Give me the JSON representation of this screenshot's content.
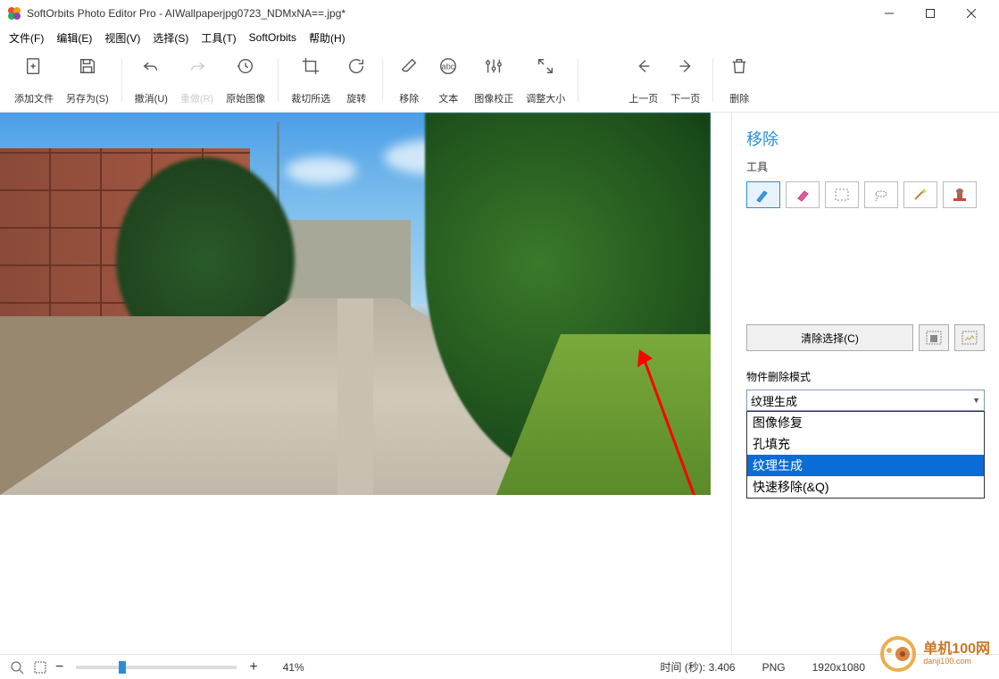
{
  "title": "SoftOrbits Photo Editor Pro - AIWallpaperjpg0723_NDMxNA==.jpg*",
  "menu": {
    "file": "文件(F)",
    "edit": "编辑(E)",
    "view": "视图(V)",
    "select": "选择(S)",
    "tools": "工具(T)",
    "softorbits": "SoftOrbits",
    "help": "帮助(H)"
  },
  "toolbar": {
    "add_file": "添加文件",
    "save_as": "另存为(S)",
    "undo": "撤消(U)",
    "redo": "重做(R)",
    "original": "原始图像",
    "crop": "裁切所选",
    "rotate": "旋转",
    "remove": "移除",
    "text": "文本",
    "correction": "图像校正",
    "resize": "调整大小",
    "prev": "上一页",
    "next": "下一页",
    "delete": "删除"
  },
  "panel": {
    "title": "移除",
    "tools_label": "工具",
    "tools": [
      "pencil-marker",
      "eraser-marker",
      "rect-select",
      "lasso-select",
      "magic-wand",
      "stamp"
    ],
    "clear_selection": "清除选择(C)",
    "mode_label": "物件删除模式",
    "combo_value": "纹理生成",
    "options": [
      "图像修复",
      "孔填充",
      "纹理生成",
      "快速移除(&Q)"
    ],
    "highlight_index": 2
  },
  "status": {
    "zoom": "41%",
    "time_label": "时间 (秒):",
    "time_value": "3.406",
    "format": "PNG",
    "dimensions": "1920x1080"
  },
  "watermark": {
    "name": "单机100网",
    "url": "danji100.com"
  }
}
